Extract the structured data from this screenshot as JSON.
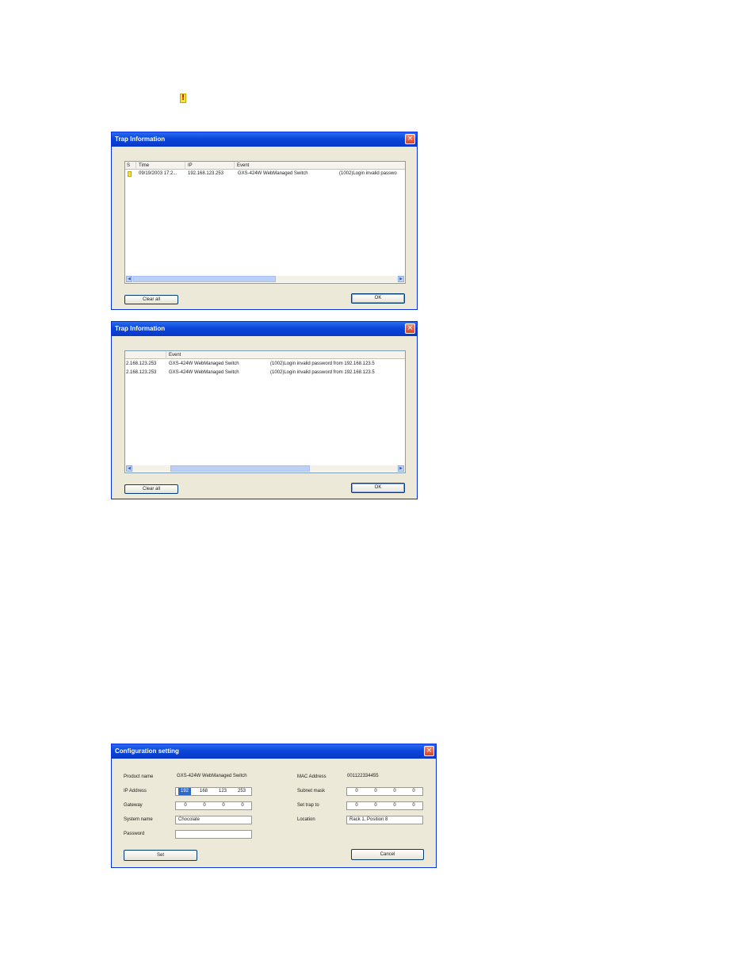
{
  "trap_window_1": {
    "title": "Trap Information",
    "columns": [
      "S",
      "Time",
      "IP",
      "Event"
    ],
    "rows": [
      {
        "time": "09/19/2003 17:2...",
        "ip": "192.168.123.253",
        "device": "GXS-424W WebManaged Switch",
        "message": "(1002)Login invalid passwo"
      }
    ],
    "clear_label": "Clear all",
    "ok_label": "OK"
  },
  "trap_window_2": {
    "title": "Trap Information",
    "columns": [
      "",
      "Event"
    ],
    "rows": [
      {
        "ip": "2.168.123.253",
        "device": "GXS-424W WebManaged Switch",
        "message": "(1002)Login invalid password from 192.168.123.5"
      },
      {
        "ip": "2.168.123.253",
        "device": "GXS-424W WebManaged Switch",
        "message": "(1002)Login invalid password from 192.168.123.5"
      }
    ],
    "clear_label": "Clear all",
    "ok_label": "OK"
  },
  "config_window": {
    "title": "Configuration setting",
    "product_name_label": "Product name",
    "product_name_value": "GXS-424W WebManaged Switch",
    "mac_label": "MAC Address",
    "mac_value": "001122334455",
    "ip_label": "IP Address",
    "ip_octets": [
      "192",
      "168",
      "123",
      "253"
    ],
    "subnet_label": "Subnet mask",
    "subnet_octets": [
      "0",
      "0",
      "0",
      "0"
    ],
    "gateway_label": "Gateway",
    "gateway_octets": [
      "0",
      "0",
      "0",
      "0"
    ],
    "trap_label": "Set trap to",
    "trap_octets": [
      "0",
      "0",
      "0",
      "0"
    ],
    "system_name_label": "System name",
    "system_name_value": "Chocolate",
    "location_label": "Location",
    "location_value": "Rack 1, Position 8",
    "password_label": "Password",
    "password_value": "",
    "set_label": "Set",
    "cancel_label": "Cancel"
  },
  "icons": {
    "warning": "warning-icon",
    "close": "close-icon"
  },
  "colors": {
    "titlebar": "#0a46d8",
    "face": "#ece9d8",
    "warn": "#f4e23a",
    "selection": "#316ac5"
  }
}
